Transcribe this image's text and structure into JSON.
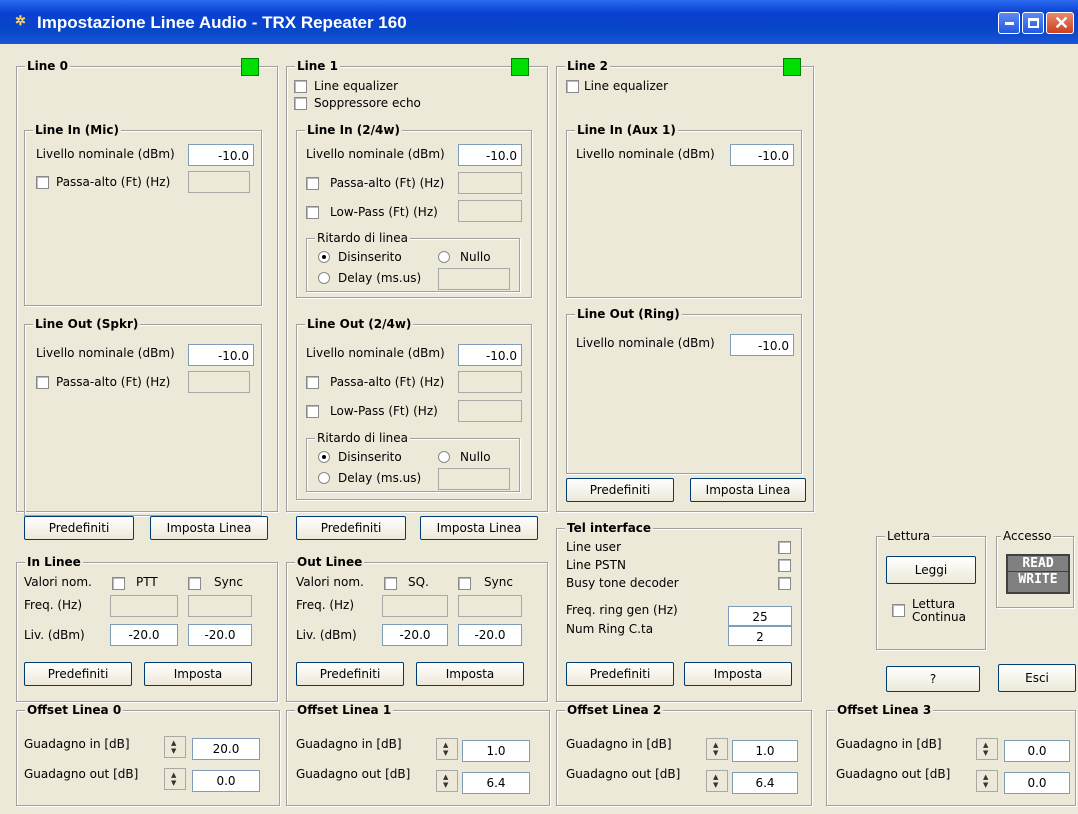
{
  "window": {
    "title": "Impostazione Linee Audio - TRX Repeater 160"
  },
  "common": {
    "livello_nominale": "Livello nominale (dBm)",
    "passa_alto": "Passa-alto (Ft) (Hz)",
    "low_pass": "Low-Pass (Ft) (Hz)",
    "ritardo": "Ritardo di linea",
    "disinserito": "Disinserito",
    "nullo": "Nullo",
    "delay": "Delay (ms.us)",
    "predefiniti": "Predefiniti",
    "imposta_linea": "Imposta Linea",
    "imposta": "Imposta",
    "guadagno_in": "Guadagno in [dB]",
    "guadagno_out": "Guadagno out [dB]",
    "line_equalizer": "Line equalizer",
    "valori_nom": "Valori nom.",
    "freq_hz": "Freq. (Hz)",
    "liv_dbm": "Liv. (dBm)",
    "sync": "Sync"
  },
  "line0": {
    "title": "Line 0",
    "in_title": "Line In (Mic)",
    "in_level": "-10.0",
    "out_title": "Line Out (Spkr)",
    "out_level": "-10.0"
  },
  "line1": {
    "title": "Line 1",
    "soppressore": "Soppressore echo",
    "in_title": "Line In (2/4w)",
    "in_level": "-10.0",
    "out_title": "Line Out (2/4w)",
    "out_level": "-10.0"
  },
  "line2": {
    "title": "Line 2",
    "in_title": "Line In (Aux 1)",
    "in_level": "-10.0",
    "out_title": "Line Out (Ring)",
    "out_level": "-10.0"
  },
  "in_linee": {
    "title": "In Linee",
    "ptt": "PTT",
    "liv1": "-20.0",
    "liv2": "-20.0"
  },
  "out_linee": {
    "title": "Out Linee",
    "sq": "SQ.",
    "liv1": "-20.0",
    "liv2": "-20.0"
  },
  "tel": {
    "title": "Tel interface",
    "line_user": "Line user",
    "line_pstn": "Line PSTN",
    "busy_tone": "Busy tone decoder",
    "freq_ring": "Freq. ring gen (Hz)",
    "freq_ring_val": "25",
    "num_ring": "Num Ring C.ta",
    "num_ring_val": "2"
  },
  "lettura": {
    "title": "Lettura",
    "leggi": "Leggi",
    "continua1": "Lettura",
    "continua2": "Continua"
  },
  "accesso": {
    "title": "Accesso",
    "read": "READ",
    "write": "WRITE"
  },
  "help_button": "?",
  "exit_button": "Esci",
  "offsets": [
    {
      "title": "Offset Linea 0",
      "gin": "20.0",
      "gout": "0.0"
    },
    {
      "title": "Offset Linea 1",
      "gin": "1.0",
      "gout": "6.4"
    },
    {
      "title": "Offset Linea 2",
      "gin": "1.0",
      "gout": "6.4"
    },
    {
      "title": "Offset Linea 3",
      "gin": "0.0",
      "gout": "0.0"
    }
  ],
  "colors": {
    "led": "#00e000",
    "titlebar": "#0847c8"
  }
}
